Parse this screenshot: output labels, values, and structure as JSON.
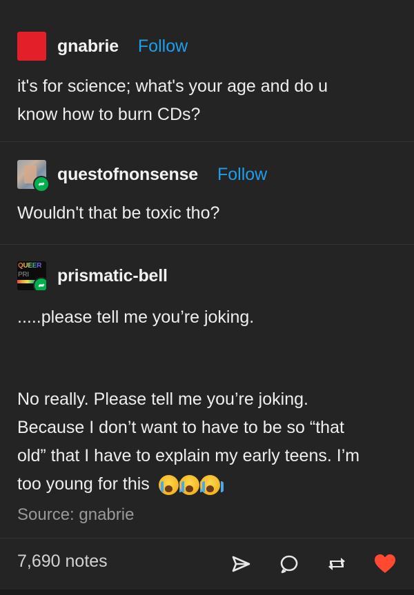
{
  "posts": [
    {
      "username": "gnabrie",
      "follow_label": "Follow",
      "text_lines": [
        "it's for science; what's your age and do u",
        "know how to burn CDs?"
      ]
    },
    {
      "username": "questofnonsense",
      "follow_label": "Follow",
      "text_lines": [
        "Wouldn't that be toxic tho?"
      ]
    },
    {
      "username": "prismatic-bell",
      "text_lines": [
        ".....please tell me you’re joking."
      ],
      "paragraph2_lines": [
        "No really. Please tell me you’re joking.",
        "Because I don’t want to have to be so “that",
        "old” that I have to explain my early teens. I’m",
        "too young for this"
      ],
      "emojis": [
        "loudly-crying-face",
        "loudly-crying-face",
        "loudly-crying-face"
      ]
    }
  ],
  "source": "Source: gnabrie",
  "footer": {
    "notes": "7,690 notes"
  },
  "avatar_text": {
    "queer": "QUEER",
    "queer_line2": "PRI"
  },
  "colors": {
    "background": "#242424",
    "follow": "#1e9fe9",
    "avatar_red": "#e3202a",
    "reblog_green": "#00b04e",
    "like_red": "#ff4930"
  },
  "icons": [
    "share-icon",
    "reply-icon",
    "reblog-icon",
    "heart-icon"
  ]
}
